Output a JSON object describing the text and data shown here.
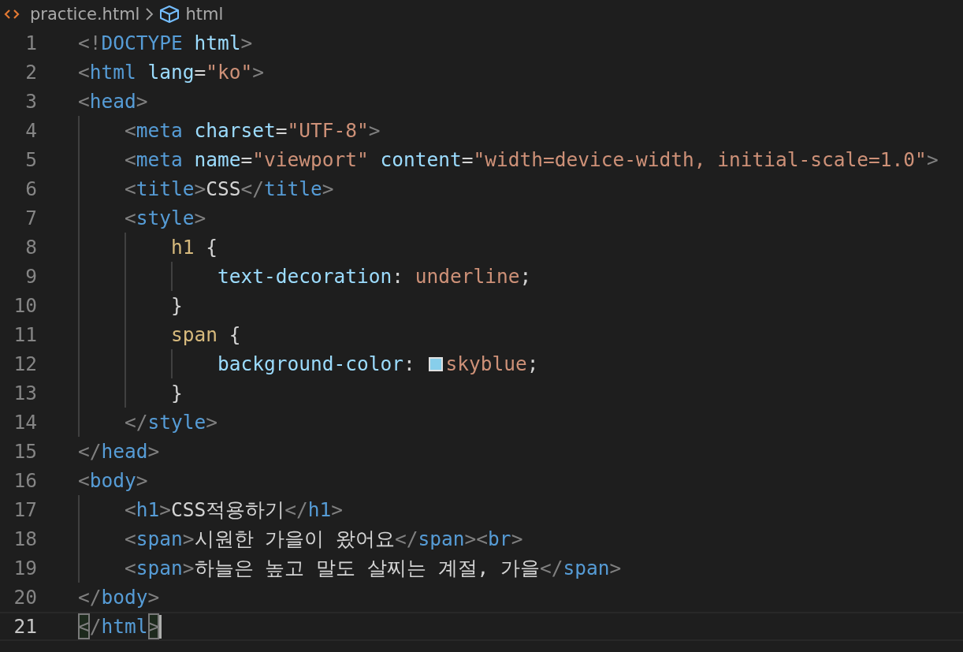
{
  "breadcrumb": {
    "file": "practice.html",
    "symbol": "html"
  },
  "lines": [
    {
      "number": "1",
      "current": false,
      "tokens": [
        {
          "kind": "bracket",
          "text": "<!"
        },
        {
          "kind": "tag",
          "text": "DOCTYPE"
        },
        {
          "kind": "attr",
          "text": " html"
        },
        {
          "kind": "bracket",
          "text": ">"
        }
      ]
    },
    {
      "number": "2",
      "current": false,
      "tokens": [
        {
          "kind": "bracket",
          "text": "<"
        },
        {
          "kind": "tag",
          "text": "html"
        },
        {
          "kind": "attr",
          "text": " lang"
        },
        {
          "kind": "punct",
          "text": "="
        },
        {
          "kind": "string",
          "text": "\"ko\""
        },
        {
          "kind": "bracket",
          "text": ">"
        }
      ]
    },
    {
      "number": "3",
      "current": false,
      "tokens": [
        {
          "kind": "bracket",
          "text": "<"
        },
        {
          "kind": "tag",
          "text": "head"
        },
        {
          "kind": "bracket",
          "text": ">"
        }
      ],
      "children": [
        {
          "number": "4",
          "current": false,
          "tokens": [
            {
              "kind": "bracket",
              "text": "<"
            },
            {
              "kind": "tag",
              "text": "meta"
            },
            {
              "kind": "attr",
              "text": " charset"
            },
            {
              "kind": "punct",
              "text": "="
            },
            {
              "kind": "string",
              "text": "\"UTF-8\""
            },
            {
              "kind": "bracket",
              "text": ">"
            }
          ]
        },
        {
          "number": "5",
          "current": false,
          "tokens": [
            {
              "kind": "bracket",
              "text": "<"
            },
            {
              "kind": "tag",
              "text": "meta"
            },
            {
              "kind": "attr",
              "text": " name"
            },
            {
              "kind": "punct",
              "text": "="
            },
            {
              "kind": "string",
              "text": "\"viewport\""
            },
            {
              "kind": "attr",
              "text": " content"
            },
            {
              "kind": "punct",
              "text": "="
            },
            {
              "kind": "string",
              "text": "\"width=device-width, initial-scale=1.0\""
            },
            {
              "kind": "bracket",
              "text": ">"
            }
          ]
        },
        {
          "number": "6",
          "current": false,
          "tokens": [
            {
              "kind": "bracket",
              "text": "<"
            },
            {
              "kind": "tag",
              "text": "title"
            },
            {
              "kind": "bracket",
              "text": ">"
            },
            {
              "kind": "text",
              "text": "CSS"
            },
            {
              "kind": "bracket",
              "text": "</"
            },
            {
              "kind": "tag",
              "text": "title"
            },
            {
              "kind": "bracket",
              "text": ">"
            }
          ]
        },
        {
          "number": "7",
          "current": false,
          "tokens": [
            {
              "kind": "bracket",
              "text": "<"
            },
            {
              "kind": "tag",
              "text": "style"
            },
            {
              "kind": "bracket",
              "text": ">"
            }
          ],
          "children": [
            {
              "number": "8",
              "current": false,
              "tokens": [
                {
                  "kind": "selector",
                  "text": "h1"
                },
                {
                  "kind": "punct",
                  "text": " {"
                }
              ],
              "children": [
                {
                  "number": "9",
                  "current": false,
                  "tokens": [
                    {
                      "kind": "property",
                      "text": "text-decoration"
                    },
                    {
                      "kind": "punct",
                      "text": ": "
                    },
                    {
                      "kind": "value",
                      "text": "underline"
                    },
                    {
                      "kind": "punct",
                      "text": ";"
                    }
                  ]
                }
              ]
            },
            {
              "number": "10",
              "current": false,
              "tokens": [
                {
                  "kind": "punct",
                  "text": "}"
                }
              ]
            },
            {
              "number": "11",
              "current": false,
              "tokens": [
                {
                  "kind": "selector",
                  "text": "span"
                },
                {
                  "kind": "punct",
                  "text": " {"
                }
              ],
              "children": [
                {
                  "number": "12",
                  "current": false,
                  "tokens": [
                    {
                      "kind": "property",
                      "text": "background-color"
                    },
                    {
                      "kind": "punct",
                      "text": ": "
                    },
                    {
                      "kind": "swatch",
                      "color": "#87ceeb"
                    },
                    {
                      "kind": "value",
                      "text": "skyblue"
                    },
                    {
                      "kind": "punct",
                      "text": ";"
                    }
                  ]
                }
              ]
            },
            {
              "number": "13",
              "current": false,
              "tokens": [
                {
                  "kind": "punct",
                  "text": "}"
                }
              ]
            }
          ]
        },
        {
          "number": "14",
          "current": false,
          "tokens": [
            {
              "kind": "bracket",
              "text": "</"
            },
            {
              "kind": "tag",
              "text": "style"
            },
            {
              "kind": "bracket",
              "text": ">"
            }
          ]
        }
      ]
    },
    {
      "number": "15",
      "current": false,
      "tokens": [
        {
          "kind": "bracket",
          "text": "</"
        },
        {
          "kind": "tag",
          "text": "head"
        },
        {
          "kind": "bracket",
          "text": ">"
        }
      ]
    },
    {
      "number": "16",
      "current": false,
      "tokens": [
        {
          "kind": "bracket",
          "text": "<"
        },
        {
          "kind": "tag",
          "text": "body"
        },
        {
          "kind": "bracket",
          "text": ">"
        }
      ],
      "children": [
        {
          "number": "17",
          "current": false,
          "tokens": [
            {
              "kind": "bracket",
              "text": "<"
            },
            {
              "kind": "tag",
              "text": "h1"
            },
            {
              "kind": "bracket",
              "text": ">"
            },
            {
              "kind": "text",
              "text": "CSS적용하기"
            },
            {
              "kind": "bracket",
              "text": "</"
            },
            {
              "kind": "tag",
              "text": "h1"
            },
            {
              "kind": "bracket",
              "text": ">"
            }
          ]
        },
        {
          "number": "18",
          "current": false,
          "tokens": [
            {
              "kind": "bracket",
              "text": "<"
            },
            {
              "kind": "tag",
              "text": "span"
            },
            {
              "kind": "bracket",
              "text": ">"
            },
            {
              "kind": "text",
              "text": "시원한 가을이 왔어요"
            },
            {
              "kind": "bracket",
              "text": "</"
            },
            {
              "kind": "tag",
              "text": "span"
            },
            {
              "kind": "bracket",
              "text": "><"
            },
            {
              "kind": "tag",
              "text": "br"
            },
            {
              "kind": "bracket",
              "text": ">"
            }
          ]
        },
        {
          "number": "19",
          "current": false,
          "tokens": [
            {
              "kind": "bracket",
              "text": "<"
            },
            {
              "kind": "tag",
              "text": "span"
            },
            {
              "kind": "bracket",
              "text": ">"
            },
            {
              "kind": "text",
              "text": "하늘은 높고 말도 살찌는 계절, 가을"
            },
            {
              "kind": "bracket",
              "text": "</"
            },
            {
              "kind": "tag",
              "text": "span"
            },
            {
              "kind": "bracket",
              "text": ">"
            }
          ]
        }
      ]
    },
    {
      "number": "20",
      "current": false,
      "tokens": [
        {
          "kind": "bracket",
          "text": "</"
        },
        {
          "kind": "tag",
          "text": "body"
        },
        {
          "kind": "bracket",
          "text": ">"
        }
      ]
    },
    {
      "number": "21",
      "current": true,
      "tokens": [
        {
          "kind": "matched-bracket",
          "text": "<"
        },
        {
          "kind": "bracket",
          "text": "/"
        },
        {
          "kind": "tag",
          "text": "html"
        },
        {
          "kind": "matched-bracket",
          "text": ">"
        }
      ]
    }
  ]
}
